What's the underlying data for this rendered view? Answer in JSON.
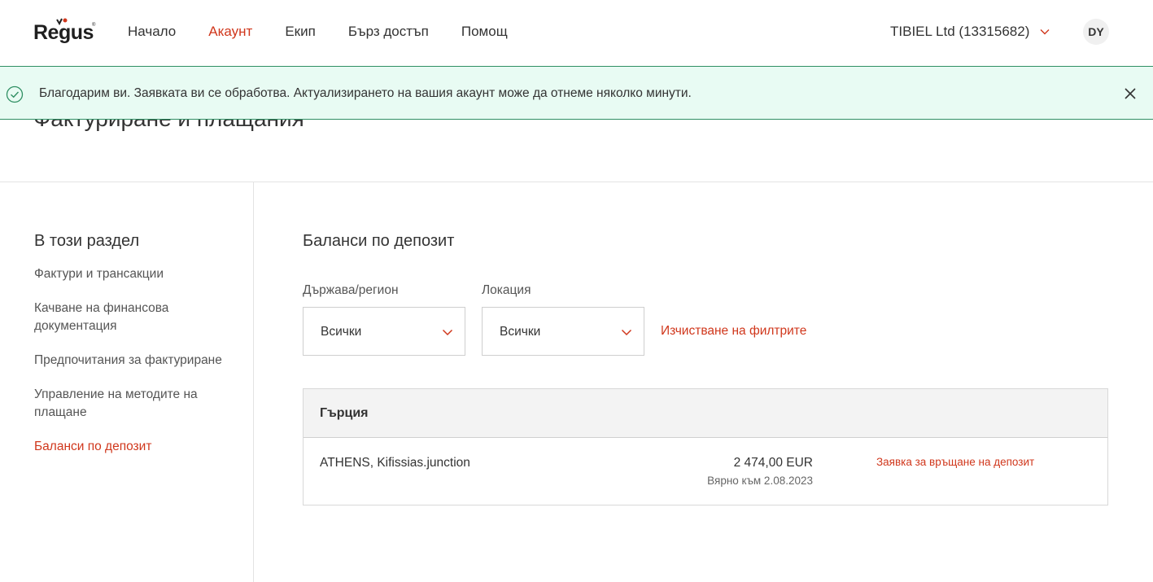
{
  "brand": {
    "logo_text": "Regus",
    "accent_color": "#d0371c",
    "success_color": "#2f8f63"
  },
  "nav": {
    "items": [
      {
        "label": "Начало",
        "active": false
      },
      {
        "label": "Акаунт",
        "active": true
      },
      {
        "label": "Екип",
        "active": false
      },
      {
        "label": "Бърз достъп",
        "active": false
      },
      {
        "label": "Помощ",
        "active": false
      }
    ]
  },
  "account": {
    "label": "TIBIEL Ltd (13315682)",
    "icon": "chevron-down-icon"
  },
  "user": {
    "initials": "DY"
  },
  "banner": {
    "message": "Благодарим ви. Заявката ви се обработва. Актуализирането на вашия акаунт може да отнеме няколко минути.",
    "icon": "check-circle-icon",
    "close_icon": "close-icon"
  },
  "page": {
    "title": "Фактуриране и плащания"
  },
  "sidebar": {
    "title": "В този раздел",
    "items": [
      {
        "label": "Фактури и трансакции",
        "active": false
      },
      {
        "label": "Качване на финансова документация",
        "active": false
      },
      {
        "label": "Предпочитания за фактуриране",
        "active": false
      },
      {
        "label": "Управление на методите на плащане",
        "active": false
      },
      {
        "label": "Баланси по депозит",
        "active": true
      }
    ]
  },
  "main": {
    "title": "Баланси по депозит",
    "filters": {
      "country": {
        "label": "Държава/регион",
        "value": "Всички"
      },
      "location": {
        "label": "Локация",
        "value": "Всички"
      },
      "clear_label": "Изчистване на филтрите"
    },
    "groups": [
      {
        "country": "Гърция",
        "rows": [
          {
            "location": "ATHENS, Kifissias.junction",
            "amount": "2 474,00 EUR",
            "as_of": "Вярно към 2.08.2023",
            "action": "Заявка за връщане на депозит"
          }
        ]
      }
    ]
  }
}
